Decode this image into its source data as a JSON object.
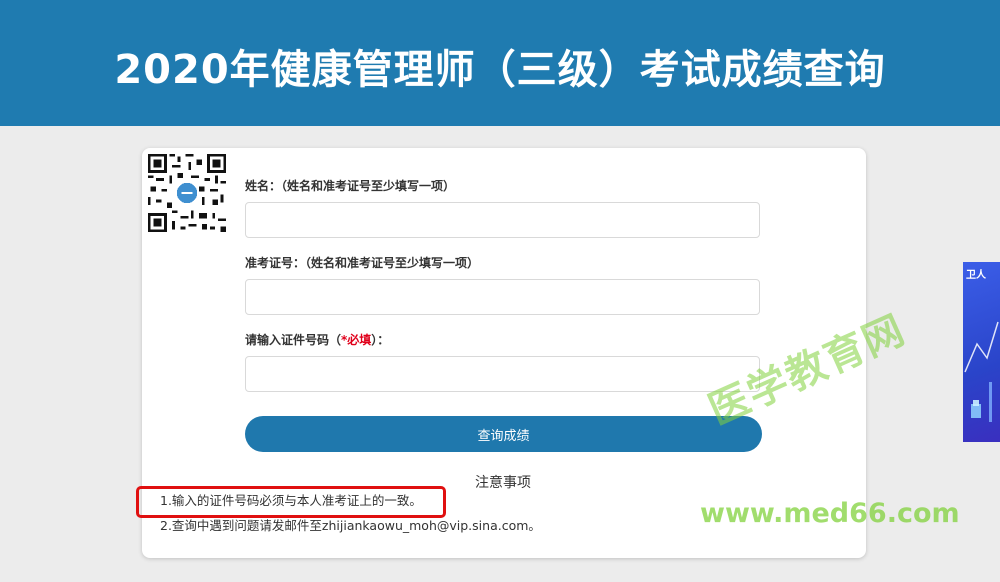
{
  "header": {
    "title": "2020年健康管理师（三级）考试成绩查询"
  },
  "form": {
    "name_label": "姓名：（姓名和准考证号至少填写一项）",
    "name_value": "",
    "ticket_label": "准考证号：（姓名和准考证号至少填写一项）",
    "ticket_value": "",
    "id_label_prefix": "请输入证件号码（",
    "id_label_required": "*必填",
    "id_label_suffix": "）：",
    "id_value": "",
    "submit_label": "查询成绩"
  },
  "notes": {
    "title": "注意事项",
    "items": [
      "1.输入的证件号码必须与本人准考证上的一致。",
      "2.查询中遇到问题请发邮件至zhijiankaowu_moh@vip.sina.com。"
    ]
  },
  "ad": {
    "text": "卫人"
  },
  "watermark": {
    "cn": "医学教育网",
    "url": "www.med66.com"
  },
  "colors": {
    "banner": "#1f7bb0",
    "button": "#1f78ad",
    "required": "#e0001b",
    "highlight": "#e01010"
  }
}
